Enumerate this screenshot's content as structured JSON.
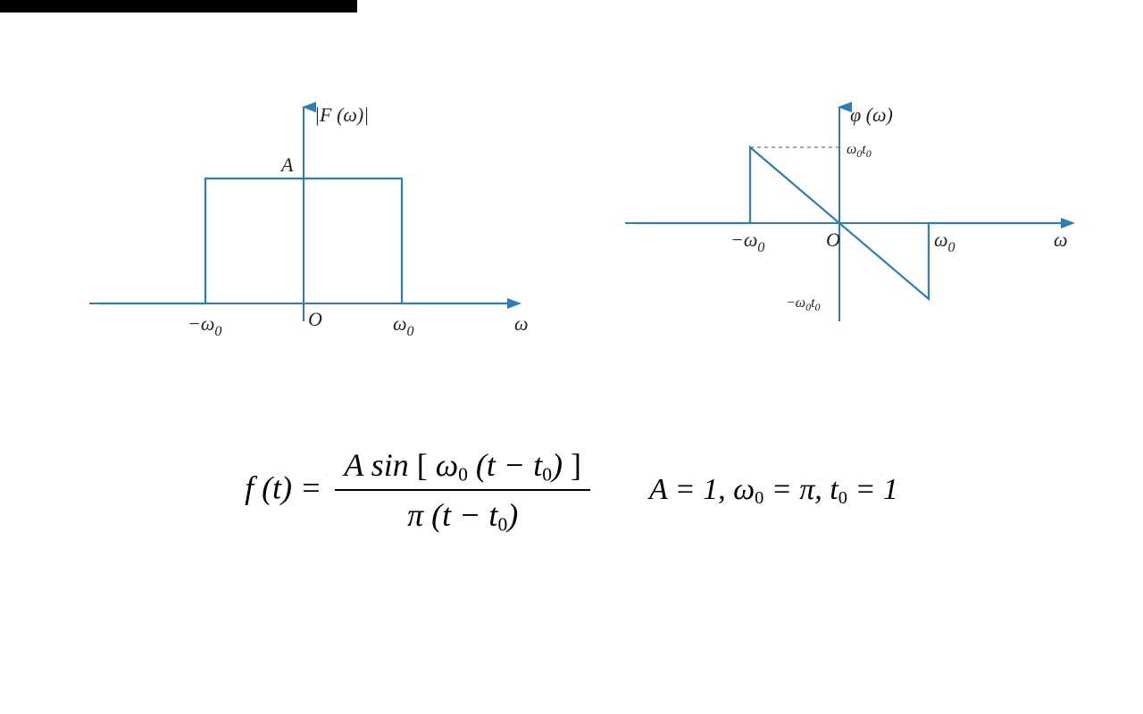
{
  "chart_data": [
    {
      "type": "line",
      "title": "|F(ω)|",
      "xlabel": "ω",
      "ylabel": "",
      "description": "Magnitude spectrum: rectangular pulse of height A on [−ω₀, ω₀], zero elsewhere",
      "x_ticks": [
        "−ω₀",
        "O",
        "ω₀"
      ],
      "y_ticks": [
        "A"
      ],
      "series": [
        {
          "name": "|F(ω)|",
          "points": [
            [
              -2,
              0
            ],
            [
              -1,
              0
            ],
            [
              -1,
              1
            ],
            [
              1,
              1
            ],
            [
              1,
              0
            ],
            [
              2,
              0
            ]
          ]
        }
      ],
      "xlim": [
        -2,
        2
      ],
      "ylim": [
        0,
        1.3
      ]
    },
    {
      "type": "line",
      "title": "φ(ω)",
      "xlabel": "ω",
      "ylabel": "",
      "description": "Phase spectrum: linear phase −ω t₀ on [−ω₀, ω₀], zero elsewhere; jumps at ±ω₀",
      "x_ticks": [
        "−ω₀",
        "O",
        "ω₀"
      ],
      "y_ticks": [
        "ω₀t₀",
        "−ω₀t₀"
      ],
      "series": [
        {
          "name": "φ(ω)",
          "points": [
            [
              -2,
              0
            ],
            [
              -1,
              0
            ],
            [
              -1,
              1
            ],
            [
              1,
              -1
            ],
            [
              1,
              0
            ],
            [
              2,
              0
            ]
          ]
        }
      ],
      "xlim": [
        -2,
        2
      ],
      "ylim": [
        -1.3,
        1.3
      ]
    }
  ],
  "labels": {
    "mag_title": "|F (ω)|",
    "mag_A": "A",
    "mag_origin": "O",
    "mag_neg_w0": "−ω",
    "mag_pos_w0": "ω",
    "mag_xaxis": "ω",
    "phase_title": "φ (ω)",
    "phase_origin": "O",
    "phase_neg_w0": "−ω",
    "phase_pos_w0": "ω",
    "phase_xaxis": "ω",
    "phase_top": "ω₀t₀",
    "phase_bottom": "−ω₀t₀",
    "sub0": "0"
  },
  "formula": {
    "lhs": "f (t) =",
    "num_prefix": "A sin",
    "num_inside_pre": "ω",
    "num_inside_mid": " (t − t",
    "num_inside_post": ")",
    "den_pre": "π (t − t",
    "den_post": ")"
  },
  "params": {
    "text": "A = 1, ω",
    "text2": " = π, t",
    "text3": " = 1"
  }
}
